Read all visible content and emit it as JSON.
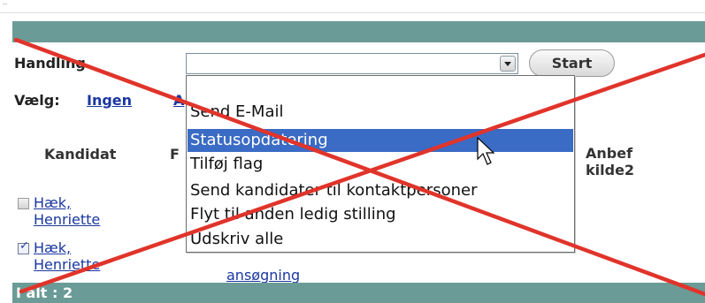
{
  "form": {
    "handling_label": "Handling",
    "start_label": "Start",
    "vaelg_label": "Vælg:",
    "vaelg_links": [
      "Ingen",
      "A"
    ]
  },
  "dropdown": {
    "options": [
      "Send E-Mail",
      "Statusopdatering",
      "Tilføj flag",
      "Send kandidater til kontaktpersoner",
      "Flyt til anden ledig stilling",
      "Udskriv alle"
    ],
    "selected_index": 1
  },
  "table": {
    "headers": [
      "Kandidat",
      "F",
      "Anbef kilde2"
    ],
    "rows": [
      {
        "checked": false,
        "name": "Hæk,\nHenriette"
      },
      {
        "checked": true,
        "name": "Hæk,\nHenriette",
        "extra": "ansøgning"
      }
    ]
  },
  "footer": {
    "total": "I alt : 2"
  },
  "colors": {
    "bar": "#6b9b96",
    "link": "#1a37a0",
    "highlight": "#3a6bc5",
    "cross": "#e0342b"
  },
  "overlay": {
    "type": "red-cross"
  },
  "icons": {
    "select_arrow": "chevron-down-icon",
    "pointer": "cursor-arrow-icon"
  }
}
